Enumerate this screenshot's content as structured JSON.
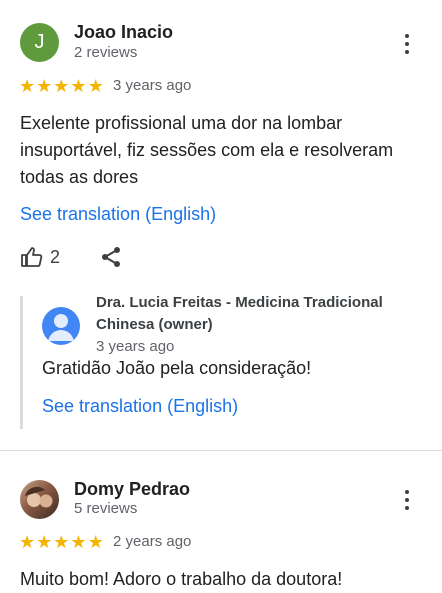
{
  "reviews": [
    {
      "author": "Joao Inacio",
      "avatar_letter": "J",
      "avatar_color": "#5f9a3c",
      "review_count": "2 reviews",
      "rating": 5,
      "age": "3 years ago",
      "text": "Exelente profissional uma dor na lombar insuportável, fiz sessões com ela e resolveram todas as dores",
      "translation_link": "See translation (English)",
      "likes": "2",
      "owner_reply": {
        "name": "Dra. Lucia Freitas - Medicina Tradicional Chinesa (owner)",
        "age": "3 years ago",
        "text": "Gratidão João pela consideração!",
        "translation_link": "See translation (English)"
      }
    },
    {
      "author": "Domy Pedrao",
      "review_count": "5 reviews",
      "rating": 5,
      "age": "2 years ago",
      "text": "Muito bom! Adoro o trabalho da doutora!"
    }
  ],
  "colors": {
    "star": "#f4b400",
    "link": "#1a73e8",
    "owner_avatar": "#4285f4"
  },
  "icons": [
    "more-vert-icon",
    "thumb-up-icon",
    "share-icon",
    "person-icon"
  ]
}
